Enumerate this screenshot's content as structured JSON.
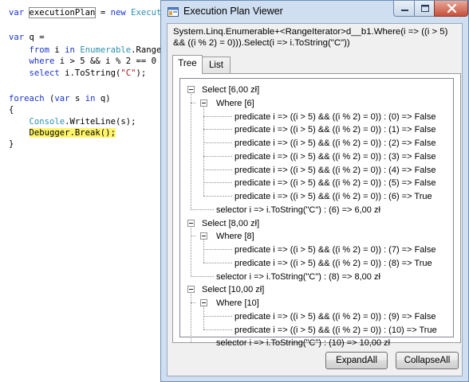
{
  "code": {
    "lines": [
      {
        "segs": [
          {
            "t": "var ",
            "c": "kw"
          },
          {
            "t": "executionPlan",
            "c": "boxed"
          },
          {
            "t": " = ",
            "c": ""
          },
          {
            "t": "new",
            "c": "kw"
          },
          {
            "t": " ",
            "c": ""
          },
          {
            "t": "Execut",
            "c": "ty"
          }
        ]
      },
      {
        "segs": []
      },
      {
        "segs": [
          {
            "t": "var ",
            "c": "kw"
          },
          {
            "t": "q =",
            "c": ""
          }
        ]
      },
      {
        "segs": [
          {
            "t": "    ",
            "c": ""
          },
          {
            "t": "from",
            "c": "kw"
          },
          {
            "t": " i ",
            "c": ""
          },
          {
            "t": "in",
            "c": "kw"
          },
          {
            "t": " ",
            "c": ""
          },
          {
            "t": "Enumerable",
            "c": "ty"
          },
          {
            "t": ".Range",
            "c": ""
          }
        ]
      },
      {
        "segs": [
          {
            "t": "    ",
            "c": ""
          },
          {
            "t": "where",
            "c": "kw"
          },
          {
            "t": " i > 5 && i % 2 == 0",
            "c": ""
          }
        ]
      },
      {
        "segs": [
          {
            "t": "    ",
            "c": ""
          },
          {
            "t": "select",
            "c": "kw"
          },
          {
            "t": " i.ToString(",
            "c": ""
          },
          {
            "t": "\"C\"",
            "c": "str"
          },
          {
            "t": ");",
            "c": ""
          }
        ]
      },
      {
        "segs": []
      },
      {
        "segs": [
          {
            "t": "foreach",
            "c": "kw"
          },
          {
            "t": " (",
            "c": ""
          },
          {
            "t": "var",
            "c": "kw"
          },
          {
            "t": " s ",
            "c": ""
          },
          {
            "t": "in",
            "c": "kw"
          },
          {
            "t": " q)",
            "c": ""
          }
        ]
      },
      {
        "segs": [
          {
            "t": "{",
            "c": ""
          }
        ]
      },
      {
        "segs": [
          {
            "t": "    ",
            "c": ""
          },
          {
            "t": "Console",
            "c": "ty"
          },
          {
            "t": ".WriteLine(s);",
            "c": ""
          }
        ]
      },
      {
        "segs": [
          {
            "t": "    ",
            "c": ""
          },
          {
            "t": "Debugger.Break();",
            "c": "hl"
          }
        ]
      },
      {
        "segs": [
          {
            "t": "}",
            "c": ""
          }
        ]
      }
    ]
  },
  "window": {
    "title": "Execution Plan Viewer",
    "expression_line1": "System.Linq.Enumerable+<RangeIterator>d__b1.Where(i => ((i > 5)",
    "expression_line2": "&& ((i % 2) = 0))).Select(i => i.ToString(\"C\"))",
    "tabs": [
      {
        "label": "Tree",
        "active": true
      },
      {
        "label": "List",
        "active": false
      }
    ],
    "tree": [
      {
        "level": 0,
        "text": "Select  [6,00 zł]",
        "expandable": true
      },
      {
        "level": 1,
        "text": "Where  [6]",
        "expandable": true
      },
      {
        "level": 2,
        "text": "predicate i => ((i > 5) && ((i % 2) = 0)) : (0) => False"
      },
      {
        "level": 2,
        "text": "predicate i => ((i > 5) && ((i % 2) = 0)) : (1) => False"
      },
      {
        "level": 2,
        "text": "predicate i => ((i > 5) && ((i % 2) = 0)) : (2) => False"
      },
      {
        "level": 2,
        "text": "predicate i => ((i > 5) && ((i % 2) = 0)) : (3) => False"
      },
      {
        "level": 2,
        "text": "predicate i => ((i > 5) && ((i % 2) = 0)) : (4) => False"
      },
      {
        "level": 2,
        "text": "predicate i => ((i > 5) && ((i % 2) = 0)) : (5) => False"
      },
      {
        "level": 2,
        "text": "predicate i => ((i > 5) && ((i % 2) = 0)) : (6) => True"
      },
      {
        "level": 1,
        "text": "selector i => i.ToString(\"C\") : (6) => 6,00 zł"
      },
      {
        "level": 0,
        "text": "Select  [8,00 zł]",
        "expandable": true
      },
      {
        "level": 1,
        "text": "Where  [8]",
        "expandable": true
      },
      {
        "level": 2,
        "text": "predicate i => ((i > 5) && ((i % 2) = 0)) : (7) => False"
      },
      {
        "level": 2,
        "text": "predicate i => ((i > 5) && ((i % 2) = 0)) : (8) => True"
      },
      {
        "level": 1,
        "text": "selector i => i.ToString(\"C\") : (8) => 8,00 zł"
      },
      {
        "level": 0,
        "text": "Select  [10,00 zł]",
        "expandable": true
      },
      {
        "level": 1,
        "text": "Where  [10]",
        "expandable": true
      },
      {
        "level": 2,
        "text": "predicate i => ((i > 5) && ((i % 2) = 0)) : (9) => False"
      },
      {
        "level": 2,
        "text": "predicate i => ((i > 5) && ((i % 2) = 0)) : (10) => True"
      },
      {
        "level": 1,
        "text": "selector i => i.ToString(\"C\") : (10) => 10,00 zł"
      }
    ],
    "buttons": {
      "expand_all": "ExpandAll",
      "collapse_all": "CollapseAll"
    }
  },
  "icons": {
    "app": "window-icon",
    "minimize": "minimize-icon",
    "maximize": "maximize-icon",
    "close": "close-icon",
    "expander": "collapse-toggle-icon"
  },
  "colors": {
    "keyword": "#1a35c9",
    "type": "#2b91af",
    "string": "#a31515",
    "highlight": "#fff46a",
    "close_button": "#c6503d",
    "window_frame": "#cfdff1"
  }
}
